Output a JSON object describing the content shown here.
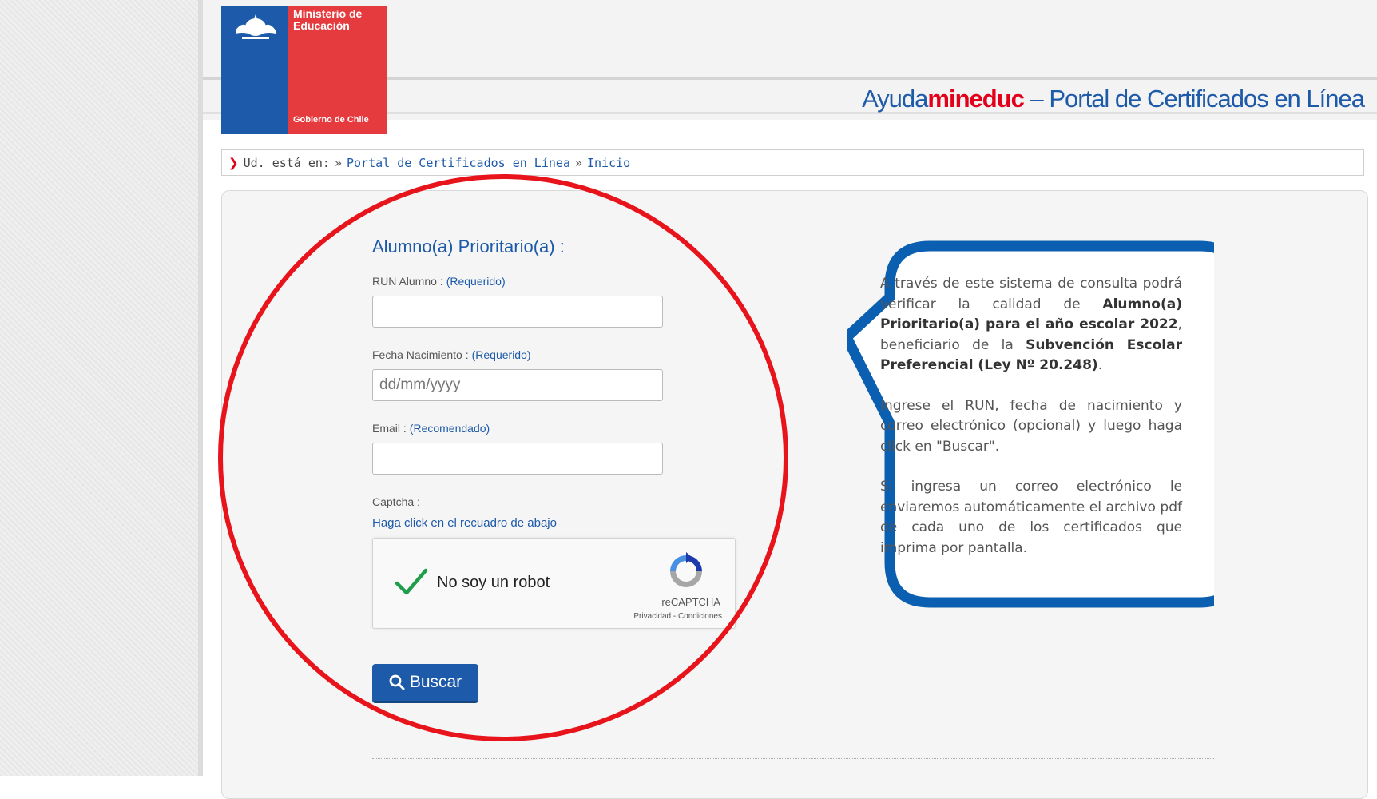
{
  "header": {
    "logo": {
      "ministerio": "Ministerio de",
      "educacion": "Educación",
      "gobierno": "Gobierno de Chile"
    },
    "site_title": {
      "prefix": "Ayuda",
      "brand": "mineduc",
      "suffix": " – Portal de Certificados en Línea"
    }
  },
  "breadcrumb": {
    "lead": "Ud. está en:",
    "sep1": "»",
    "item1": "Portal de Certificados en Línea",
    "sep2": "»",
    "item2": "Inicio"
  },
  "form": {
    "title": "Alumno(a) Prioritario(a) :",
    "run_label": "RUN Alumno :",
    "run_req": "(Requerido)",
    "run_value": "",
    "fecha_label": "Fecha Nacimiento :",
    "fecha_req": "(Requerido)",
    "fecha_placeholder": "dd/mm/yyyy",
    "email_label": "Email :",
    "email_req": "(Recomendado)",
    "email_value": "",
    "captcha_label": "Captcha :",
    "captcha_link": "Haga click en el recuadro de abajo",
    "recaptcha_text": "No soy un robot",
    "recaptcha_brand": "reCAPTCHA",
    "recaptcha_links": "Privacidad - Condiciones",
    "search_button": "Buscar"
  },
  "info": {
    "p1_a": "A través de este sistema de consulta podrá verificar la calidad de ",
    "p1_b": "Alumno(a) Prioritario(a)  para el año escolar 2022",
    "p1_c": ", beneficiario de la ",
    "p1_d": "Subvención Escolar Preferencial (Ley Nº 20.248)",
    "p1_e": ".",
    "p2": "Ingrese el RUN, fecha de nacimiento y correo electrónico (opcional) y luego haga click en \"Buscar\".",
    "p3": "Si ingresa un correo electrónico le enviaremos automáticamente el archivo pdf de cada uno de los certificados que imprima por pantalla."
  },
  "colors": {
    "brand_blue": "#1d5aa9",
    "brand_red": "#e2001a",
    "annotation_red": "#e8141c"
  }
}
